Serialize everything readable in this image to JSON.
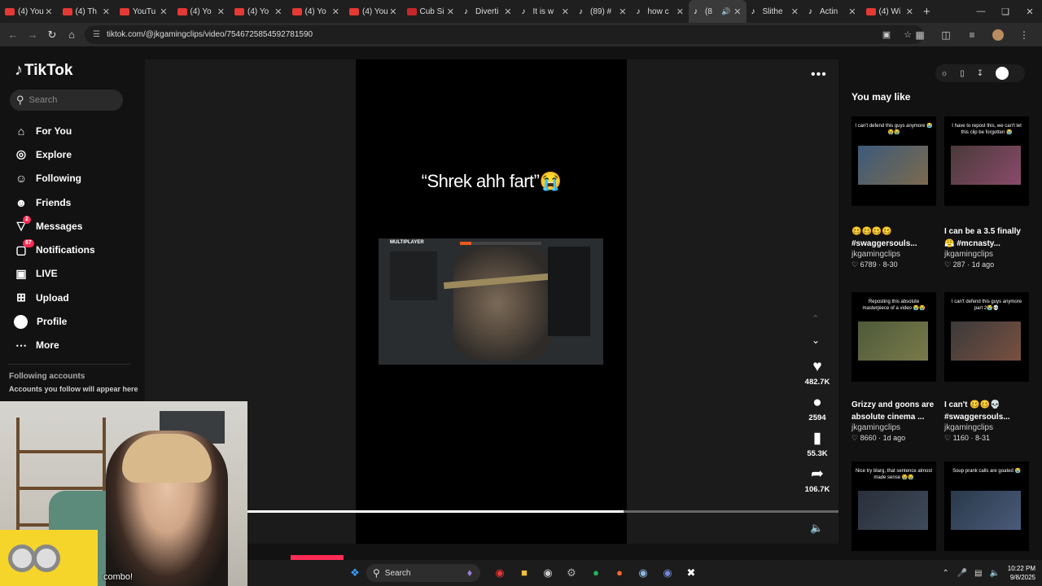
{
  "browser": {
    "tabs": [
      {
        "label": "(4) You",
        "icon": "youtube"
      },
      {
        "label": "(4) Th",
        "icon": "youtube"
      },
      {
        "label": "YouTu",
        "icon": "youtube"
      },
      {
        "label": "(4) Yo",
        "icon": "youtube"
      },
      {
        "label": "(4) Yo",
        "icon": "youtube"
      },
      {
        "label": "(4) Yo",
        "icon": "youtube"
      },
      {
        "label": "(4) You",
        "icon": "youtube"
      },
      {
        "label": "Cub Si",
        "icon": "cub"
      },
      {
        "label": "Diverti",
        "icon": "tiktok"
      },
      {
        "label": "It is w",
        "icon": "tiktok"
      },
      {
        "label": "(89) #",
        "icon": "tiktok"
      },
      {
        "label": "how c",
        "icon": "tiktok"
      },
      {
        "label": "(8",
        "icon": "tiktok",
        "active": true
      },
      {
        "label": "Slithe",
        "icon": "tiktok"
      },
      {
        "label": "Actin",
        "icon": "tiktok"
      },
      {
        "label": "(4) Wi",
        "icon": "youtube"
      }
    ],
    "url": "tiktok.com/@jkgamingclips/video/7546725854592781590"
  },
  "sidebar": {
    "logo": "TikTok",
    "search_placeholder": "Search",
    "items": [
      {
        "label": "For You",
        "icon": "home-icon"
      },
      {
        "label": "Explore",
        "icon": "compass-icon"
      },
      {
        "label": "Following",
        "icon": "following-icon"
      },
      {
        "label": "Friends",
        "icon": "friends-icon"
      },
      {
        "label": "Messages",
        "icon": "messages-icon",
        "badge": "2"
      },
      {
        "label": "Notifications",
        "icon": "bell-icon",
        "badge": "87"
      },
      {
        "label": "LIVE",
        "icon": "live-icon"
      },
      {
        "label": "Upload",
        "icon": "upload-icon"
      },
      {
        "label": "Profile",
        "icon": "profile-icon"
      },
      {
        "label": "More",
        "icon": "more-icon"
      }
    ],
    "following_title": "Following accounts",
    "following_sub": "Accounts you follow will appear here"
  },
  "video": {
    "caption": "“Shrek ahh fart”😭",
    "game_header": "MULTIPLAYER",
    "progress": 0.637,
    "actions": [
      {
        "name": "like",
        "icon": "heart-icon",
        "count": "482.7K"
      },
      {
        "name": "comment",
        "icon": "comment-icon",
        "count": "2594"
      },
      {
        "name": "save",
        "icon": "bookmark-icon",
        "count": "55.3K"
      },
      {
        "name": "share",
        "icon": "share-icon",
        "count": "106.7K"
      }
    ]
  },
  "recommendations": {
    "title": "You may like",
    "cards": [
      {
        "thumb_text": "I can't defend this guys anymore 😭😭😭",
        "title": "",
        "user": "",
        "likes": "",
        "date": ""
      },
      {
        "thumb_text": "I have to repost this, we can't let this clip be forgotten 😭",
        "title": "",
        "user": "",
        "likes": "",
        "date": ""
      },
      {
        "thumb_text": "",
        "title": "🥴🥴🥴🥴 #swaggersouls...",
        "user": "jkgamingclips",
        "likes": "6789",
        "date": "8-30"
      },
      {
        "thumb_text": "",
        "title": "I can be a 3.5 finally 😤 #mcnasty...",
        "user": "jkgamingclips",
        "likes": "287",
        "date": "1d ago"
      },
      {
        "thumb_text": "Reposting this absolute masterpiece of a video 😭😭",
        "title": "",
        "user": "",
        "likes": "",
        "date": ""
      },
      {
        "thumb_text": "I can't defend this guys anymore part 2😭💀",
        "title": "",
        "user": "",
        "likes": "",
        "date": ""
      },
      {
        "thumb_text": "",
        "title": "Grizzy and goons are absolute cinema ...",
        "user": "jkgamingclips",
        "likes": "8660",
        "date": "1d ago"
      },
      {
        "thumb_text": "",
        "title": "I can't 🥴🥴💀 #swaggersouls...",
        "user": "jkgamingclips",
        "likes": "1160",
        "date": "8-31"
      },
      {
        "thumb_text": "Nice try blarg, that sentence almost made sense 😭😭",
        "title": "",
        "user": "",
        "likes": "",
        "date": ""
      },
      {
        "thumb_text": "Soup prank calls are goated 😭",
        "title": "",
        "user": "",
        "likes": "",
        "date": ""
      }
    ]
  },
  "overlay": {
    "combo_text": "combo!"
  },
  "taskbar": {
    "search_label": "Search",
    "time": "10:22 PM",
    "date": "9/8/2025"
  },
  "colors": {
    "accent": "#fe2c55",
    "background": "#121212",
    "player_bg": "#1b1b1b"
  }
}
